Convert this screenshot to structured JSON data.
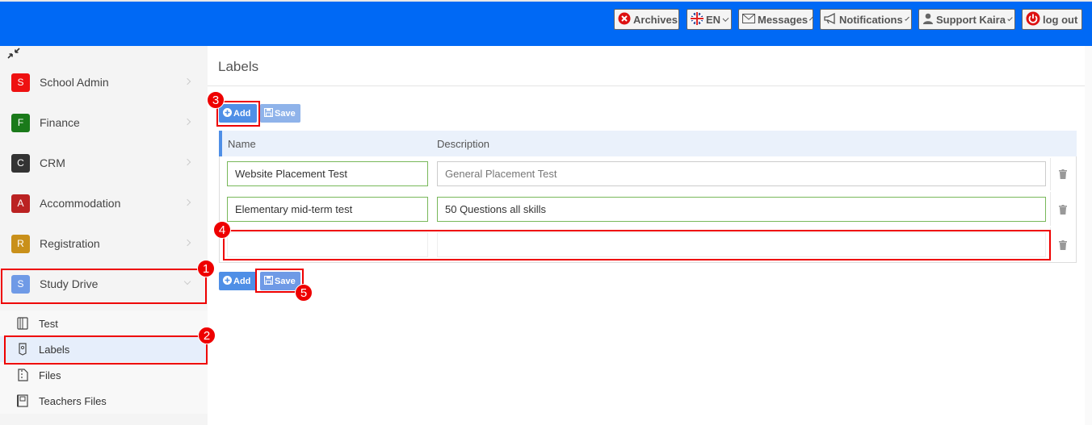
{
  "topbar": {
    "archives": "Archives",
    "language": "EN",
    "messages": "Messages",
    "notifications": "Notifications",
    "user": "Support Kaira",
    "logout": "log out"
  },
  "sidebar": {
    "modules": [
      {
        "letter": "S",
        "label": "School Admin",
        "color": "#e11"
      },
      {
        "letter": "F",
        "label": "Finance",
        "color": "#1a7a1a"
      },
      {
        "letter": "C",
        "label": "CRM",
        "color": "#333"
      },
      {
        "letter": "A",
        "label": "Accommodation",
        "color": "#b22"
      },
      {
        "letter": "R",
        "label": "Registration",
        "color": "#c9901a"
      },
      {
        "letter": "S",
        "label": "Study Drive",
        "color": "#6f9ae6"
      }
    ],
    "submenu": [
      {
        "label": "Test"
      },
      {
        "label": "Labels"
      },
      {
        "label": "Files"
      },
      {
        "label": "Teachers Files"
      }
    ]
  },
  "page": {
    "title": "Labels",
    "add_label": "Add",
    "save_label": "Save"
  },
  "table": {
    "headers": {
      "name": "Name",
      "description": "Description"
    },
    "rows": [
      {
        "name": "Website Placement Test",
        "description": "General Placement Test"
      },
      {
        "name": "Elementary mid-term test",
        "description": "50 Questions all skills"
      },
      {
        "name": "",
        "description": ""
      }
    ]
  },
  "annotations": [
    "1",
    "2",
    "3",
    "4",
    "5"
  ]
}
